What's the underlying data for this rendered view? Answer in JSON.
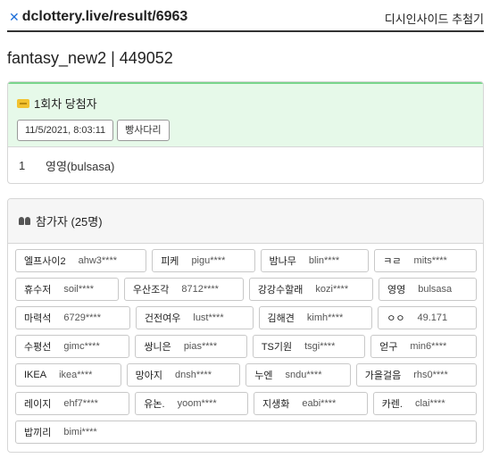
{
  "header": {
    "brand_icon": "x-logo-icon",
    "brand_text": "dclottery.live/result/6963",
    "nav_link": "디시인사이드 추첨기"
  },
  "page_title": "fantasy_new2 | 449052",
  "winner": {
    "title": "1회차 당첨자",
    "datetime": "11/5/2021, 8:03:11",
    "method": "빵사다리",
    "rows": [
      {
        "rank": "1",
        "name": "영영(bulsasa)"
      }
    ]
  },
  "participants": {
    "title": "참가자 (25명)",
    "rows": [
      [
        {
          "nick": "엘프사이2",
          "id": "ahw3****"
        },
        {
          "nick": "피케",
          "id": "pigu****"
        },
        {
          "nick": "밤나무",
          "id": "blin****"
        },
        {
          "nick": "ㅋㄹ",
          "id": "mits****"
        }
      ],
      [
        {
          "nick": "휴수저",
          "id": "soil****"
        },
        {
          "nick": "우산조각",
          "id": "8712****"
        },
        {
          "nick": "강강수할래",
          "id": "kozi****"
        },
        {
          "nick": "영영",
          "id": "bulsasa"
        }
      ],
      [
        {
          "nick": "마력석",
          "id": "6729****"
        },
        {
          "nick": "건전여우",
          "id": "lust****"
        },
        {
          "nick": "김해견",
          "id": "kimh****"
        },
        {
          "nick": "ㅇㅇ",
          "id": "49.171"
        }
      ],
      [
        {
          "nick": "수평선",
          "id": "gimc****"
        },
        {
          "nick": "쌍니은",
          "id": "pias****"
        },
        {
          "nick": "TS기원",
          "id": "tsgi****"
        },
        {
          "nick": "얻구",
          "id": "min6****"
        }
      ],
      [
        {
          "nick": "IKEA",
          "id": "ikea****"
        },
        {
          "nick": "망아지",
          "id": "dnsh****"
        },
        {
          "nick": "누엔",
          "id": "sndu****"
        },
        {
          "nick": "가을걸음",
          "id": "rhs0****"
        }
      ],
      [
        {
          "nick": "레이지",
          "id": "ehf7****"
        },
        {
          "nick": "유논.",
          "id": "yoom****"
        },
        {
          "nick": "지생화",
          "id": "eabi****"
        },
        {
          "nick": "카렌.",
          "id": "clai****"
        }
      ],
      [
        {
          "nick": "밥끼리",
          "id": "bimi****"
        }
      ]
    ]
  },
  "colors": {
    "winner_bg": "#e6f9e9",
    "winner_border": "#79d58c",
    "brand_icon": "#1e6fd9"
  }
}
